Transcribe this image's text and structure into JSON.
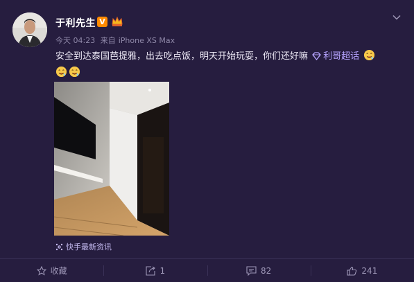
{
  "post": {
    "author": "于利先生",
    "verified_badge": "V",
    "time": "今天 04:23",
    "source_prefix": "来自",
    "device": "iPhone XS Max",
    "text": "安全到达泰国芭提雅，出去吃点饭，明天开始玩耍，你们还好嘛",
    "topic_link": "利哥超话",
    "attribution": "快手最新资讯"
  },
  "actions": {
    "favorite_label": "收藏",
    "repost_count": "1",
    "comment_count": "82",
    "like_count": "241"
  },
  "icons": {
    "avatar": "avatar-photo",
    "badge": "verified-v-icon",
    "crown": "member-crown-icon",
    "menu": "chevron-down-icon",
    "topic": "topic-diamond-icon",
    "emoji": "drooling-face-emoji",
    "source": "kuaishou-icon",
    "favorite": "star-icon",
    "repost": "repost-icon",
    "comment": "comment-icon",
    "like": "thumbs-up-icon"
  },
  "colors": {
    "background": "#261d3f",
    "link": "#b6a4ff",
    "badge": "#ff8a00",
    "muted": "#8f88a8"
  }
}
